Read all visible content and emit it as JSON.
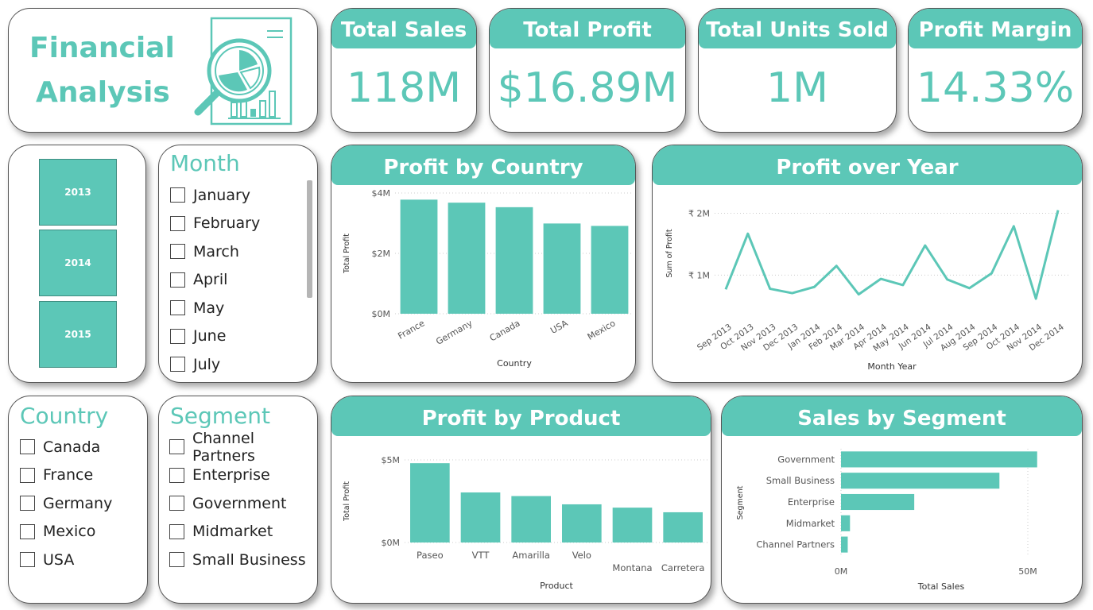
{
  "header": {
    "title_line1": "Financial",
    "title_line2": "Analysis",
    "logo_icon": "report-magnifier-icon"
  },
  "kpis": [
    {
      "label": "Total Sales",
      "value": "118M"
    },
    {
      "label": "Total Profit",
      "value": "$16.89M"
    },
    {
      "label": "Total Units Sold",
      "value": "1M"
    },
    {
      "label": "Profit Margin",
      "value": "14.33%"
    }
  ],
  "year_slicer": {
    "years": [
      "2013",
      "2014",
      "2015"
    ]
  },
  "month_slicer": {
    "title": "Month",
    "items": [
      "January",
      "February",
      "March",
      "April",
      "May",
      "June",
      "July"
    ]
  },
  "country_slicer": {
    "title": "Country",
    "items": [
      "Canada",
      "France",
      "Germany",
      "Mexico",
      "USA"
    ]
  },
  "segment_slicer": {
    "title": "Segment",
    "items": [
      "Channel Partners",
      "Enterprise",
      "Government",
      "Midmarket",
      "Small Business"
    ]
  },
  "colors": {
    "accent": "#5cc7b7",
    "border": "#555555"
  },
  "chart_data": [
    {
      "id": "profit_by_country",
      "type": "bar",
      "title": "Profit by Country",
      "xlabel": "Country",
      "ylabel": "Total Profit",
      "categories": [
        "France",
        "Germany",
        "Canada",
        "USA",
        "Mexico"
      ],
      "values": [
        3.78,
        3.68,
        3.53,
        2.99,
        2.91
      ],
      "ylim": [
        0,
        4
      ],
      "yticks": [
        {
          "v": 0,
          "label": "$0M"
        },
        {
          "v": 2,
          "label": "$2M"
        },
        {
          "v": 4,
          "label": "$4M"
        }
      ],
      "grid": true
    },
    {
      "id": "profit_over_year",
      "type": "line",
      "title": "Profit over Year",
      "xlabel": "Month Year",
      "ylabel": "Sum of Profit",
      "x": [
        "Sep 2013",
        "Oct 2013",
        "Nov 2013",
        "Dec 2013",
        "Jan 2014",
        "Feb 2014",
        "Mar 2014",
        "Apr 2014",
        "May 2014",
        "Jun 2014",
        "Jul 2014",
        "Aug 2014",
        "Sep 2014",
        "Oct 2014",
        "Nov 2014",
        "Dec 2014"
      ],
      "values": [
        0.77,
        1.67,
        0.78,
        0.71,
        0.81,
        1.15,
        0.69,
        0.94,
        0.84,
        1.48,
        0.93,
        0.79,
        1.03,
        1.79,
        0.62,
        2.05
      ],
      "ylim": [
        0.3,
        2.25
      ],
      "yticks": [
        {
          "v": 1,
          "label": "₹ 1M"
        },
        {
          "v": 2,
          "label": "₹ 2M"
        }
      ],
      "grid": true
    },
    {
      "id": "profit_by_product",
      "type": "bar",
      "title": "Profit by Product",
      "xlabel": "Product",
      "ylabel": "Total Profit",
      "categories": [
        "Paseo",
        "VTT",
        "Amarilla",
        "Velo",
        "Montana",
        "Carretera"
      ],
      "values": [
        4.8,
        3.03,
        2.81,
        2.31,
        2.11,
        1.83
      ],
      "ylim": [
        0,
        5
      ],
      "yticks": [
        {
          "v": 0,
          "label": "$0M"
        },
        {
          "v": 5,
          "label": "$5M"
        }
      ],
      "grid": true
    },
    {
      "id": "sales_by_segment",
      "type": "bar",
      "orientation": "horizontal",
      "title": "Sales by Segment",
      "xlabel": "Total Sales",
      "ylabel": "Segment",
      "categories": [
        "Government",
        "Small Business",
        "Enterprise",
        "Midmarket",
        "Channel Partners"
      ],
      "values": [
        52.5,
        42.4,
        19.6,
        2.4,
        1.8
      ],
      "xlim": [
        0,
        60
      ],
      "xticks": [
        {
          "v": 0,
          "label": "0M"
        },
        {
          "v": 50,
          "label": "50M"
        }
      ],
      "grid": true
    }
  ]
}
